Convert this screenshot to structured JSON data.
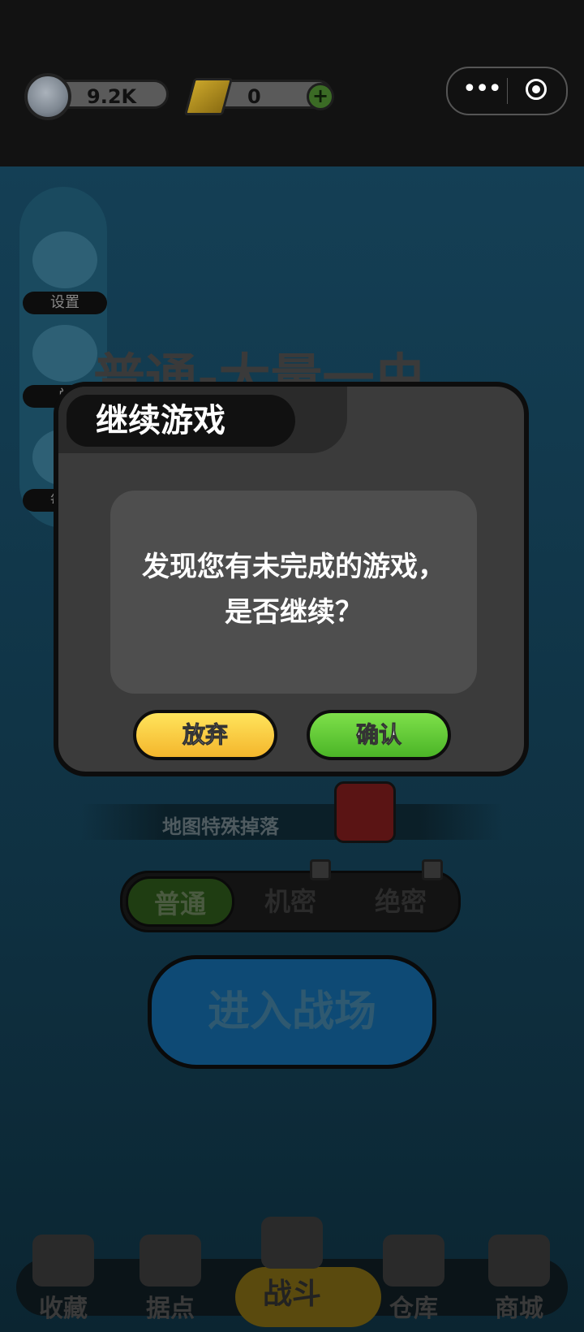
{
  "resources": {
    "coins": "9.2K",
    "gold": "0",
    "add_symbol": "+"
  },
  "capsule": {
    "more": "•••",
    "close": ""
  },
  "sidebar": {
    "items": [
      {
        "label": "设置",
        "icon": "gear-icon"
      },
      {
        "label": "兑",
        "icon": "hamster-icon"
      },
      {
        "label": "每日",
        "icon": "card-icon"
      }
    ]
  },
  "level_title": "普通-大量一虫",
  "drop_label": "地图特殊掉落",
  "modes": [
    "普通",
    "机密",
    "绝密"
  ],
  "enter_button": "进入战场",
  "nav": [
    {
      "label": "收藏",
      "icon": "book-icon"
    },
    {
      "label": "据点",
      "icon": "base-icon"
    },
    {
      "label": "战斗",
      "icon": "battle-icon"
    },
    {
      "label": "仓库",
      "icon": "warehouse-icon"
    },
    {
      "label": "商城",
      "icon": "shop-icon"
    }
  ],
  "dialog": {
    "title": "继续游戏",
    "message": "发现您有未完成的游戏，是否继续？",
    "quit_label": "放弃",
    "confirm_label": "确认"
  }
}
